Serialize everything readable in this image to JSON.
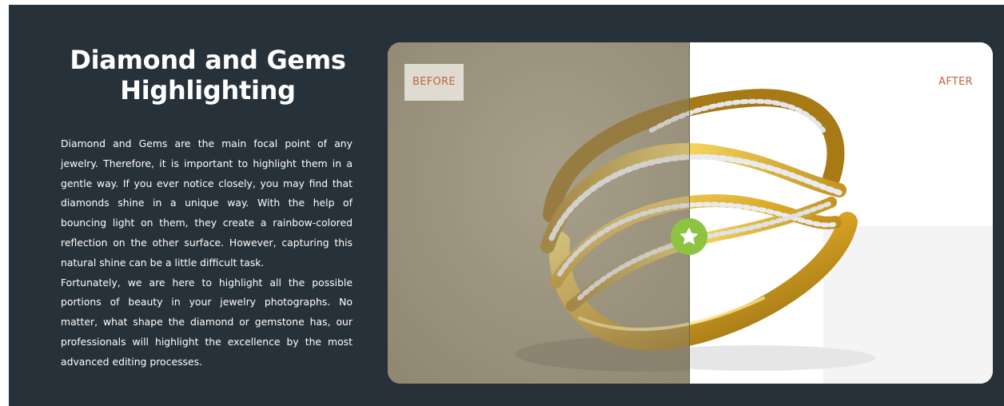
{
  "section": {
    "title": "Diamond and Gems Highlighting",
    "paragraphs": [
      "Diamond and Gems are the main focal point of any jewelry. Therefore, it is important to highlight them in a gentle way. If you ever notice closely, you may find that diamonds shine in a unique way. With the help of bouncing light on them, they create a rainbow-colored reflection on the other surface. However, capturing this natural shine can be a little difficult task.",
      "Fortunately, we are here to highlight all the possible portions of beauty in your jewelry photographs. No matter, what shape the diamond or gemstone has, our professionals will highlight the excellence by the most advanced editing processes."
    ]
  },
  "comparison": {
    "before_label": "BEFORE",
    "after_label": "AFTER",
    "handle_icon": "star-icon",
    "slider_position": 0.5
  },
  "colors": {
    "background": "#273139",
    "label_text": "#c2633e",
    "handle": "#8cc341",
    "before_backdrop": "#a59e8b",
    "after_backdrop": "#ffffff"
  }
}
